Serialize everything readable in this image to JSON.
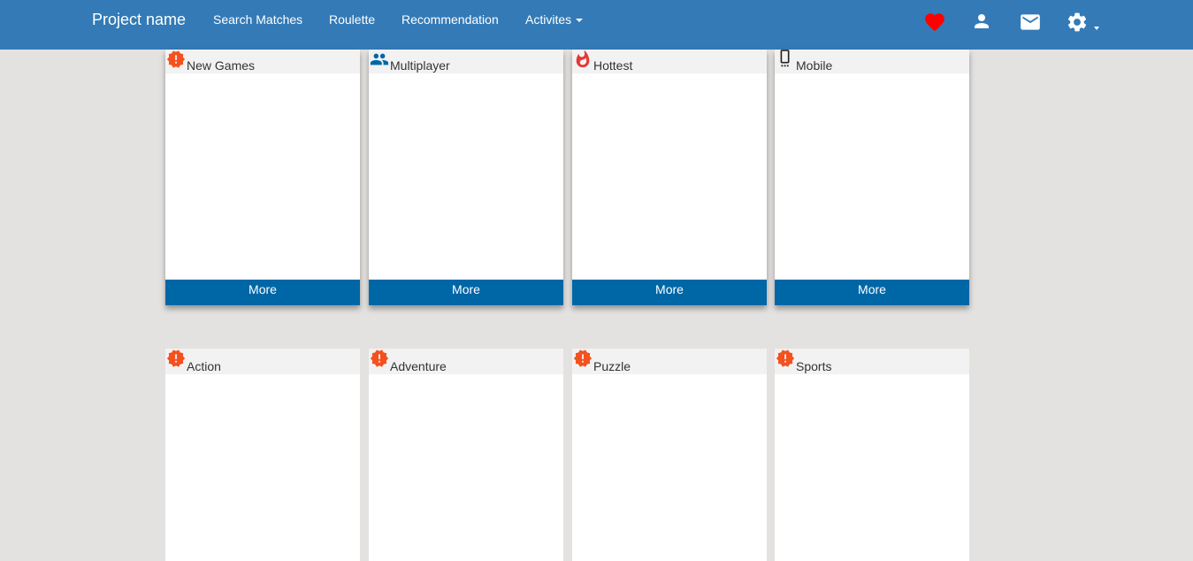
{
  "navbar": {
    "brand": "Project name",
    "links": [
      "Search Matches",
      "Roulette",
      "Recommendation",
      "Activites"
    ],
    "icons": [
      "heart-icon",
      "user-icon",
      "mail-icon",
      "gear-icon"
    ],
    "colors": {
      "background": "#337ab7",
      "heart": "#ff0000",
      "icon": "#ffffff"
    }
  },
  "cards": [
    {
      "title": "New Games",
      "icon": "alert-badge-icon",
      "button": "More"
    },
    {
      "title": "Multiplayer",
      "icon": "people-icon",
      "button": "More"
    },
    {
      "title": "Hottest",
      "icon": "flame-icon",
      "button": "More"
    },
    {
      "title": "Mobile",
      "icon": "mobile-phone-icon",
      "button": "More"
    },
    {
      "title": "Action",
      "icon": "alert-badge-icon"
    },
    {
      "title": "Adventure",
      "icon": "alert-badge-icon"
    },
    {
      "title": "Puzzle",
      "icon": "alert-badge-icon"
    },
    {
      "title": "Sports",
      "icon": "alert-badge-icon"
    }
  ],
  "colors": {
    "page_background": "#e4e2e0",
    "more_button": "#0067a7",
    "alert_icon": "#f4511e",
    "people_icon": "#0067a7",
    "flame_icon": "#e53935"
  }
}
